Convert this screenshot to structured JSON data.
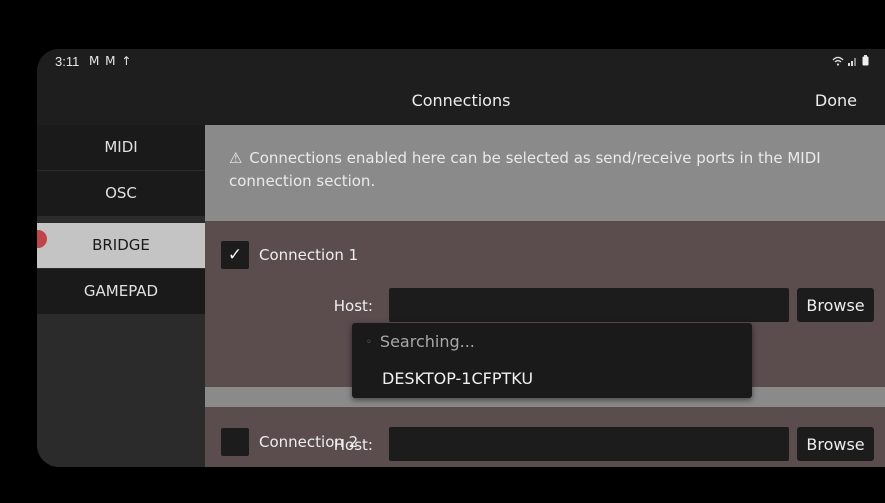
{
  "status_bar": {
    "time": "3:11",
    "left_icons": "M M ↑"
  },
  "header": {
    "title": "Connections",
    "done_label": "Done"
  },
  "sidebar": {
    "items": [
      {
        "label": "MIDI",
        "active": false
      },
      {
        "label": "OSC",
        "active": false
      },
      {
        "label": "BRIDGE",
        "active": true
      },
      {
        "label": "GAMEPAD",
        "active": false
      }
    ]
  },
  "info": {
    "icon": "⚠",
    "text": "Connections enabled here can be selected as send/receive ports in the MIDI connection section."
  },
  "connections": [
    {
      "label": "Connection 1",
      "checked": true,
      "check_glyph": "✓",
      "host_label": "Host:",
      "host_value": "",
      "browse_label": "Browse"
    },
    {
      "label": "Connection 2",
      "checked": false,
      "check_glyph": "",
      "host_label": "Host:",
      "host_value": "",
      "browse_label": "Browse"
    }
  ],
  "dropdown": {
    "searching_label": "Searching...",
    "spinner_glyph": "◦",
    "devices": [
      "DESKTOP-1CFPTKU"
    ]
  },
  "colors": {
    "background": "#000000",
    "header": "#1e1e1e",
    "sidebar_item": "#1a1a1a",
    "sidebar_active": "#c4c4c4",
    "panel": "#5b4c4e",
    "info_box": "#8a8a8a",
    "accent_dot": "#c0454a"
  }
}
